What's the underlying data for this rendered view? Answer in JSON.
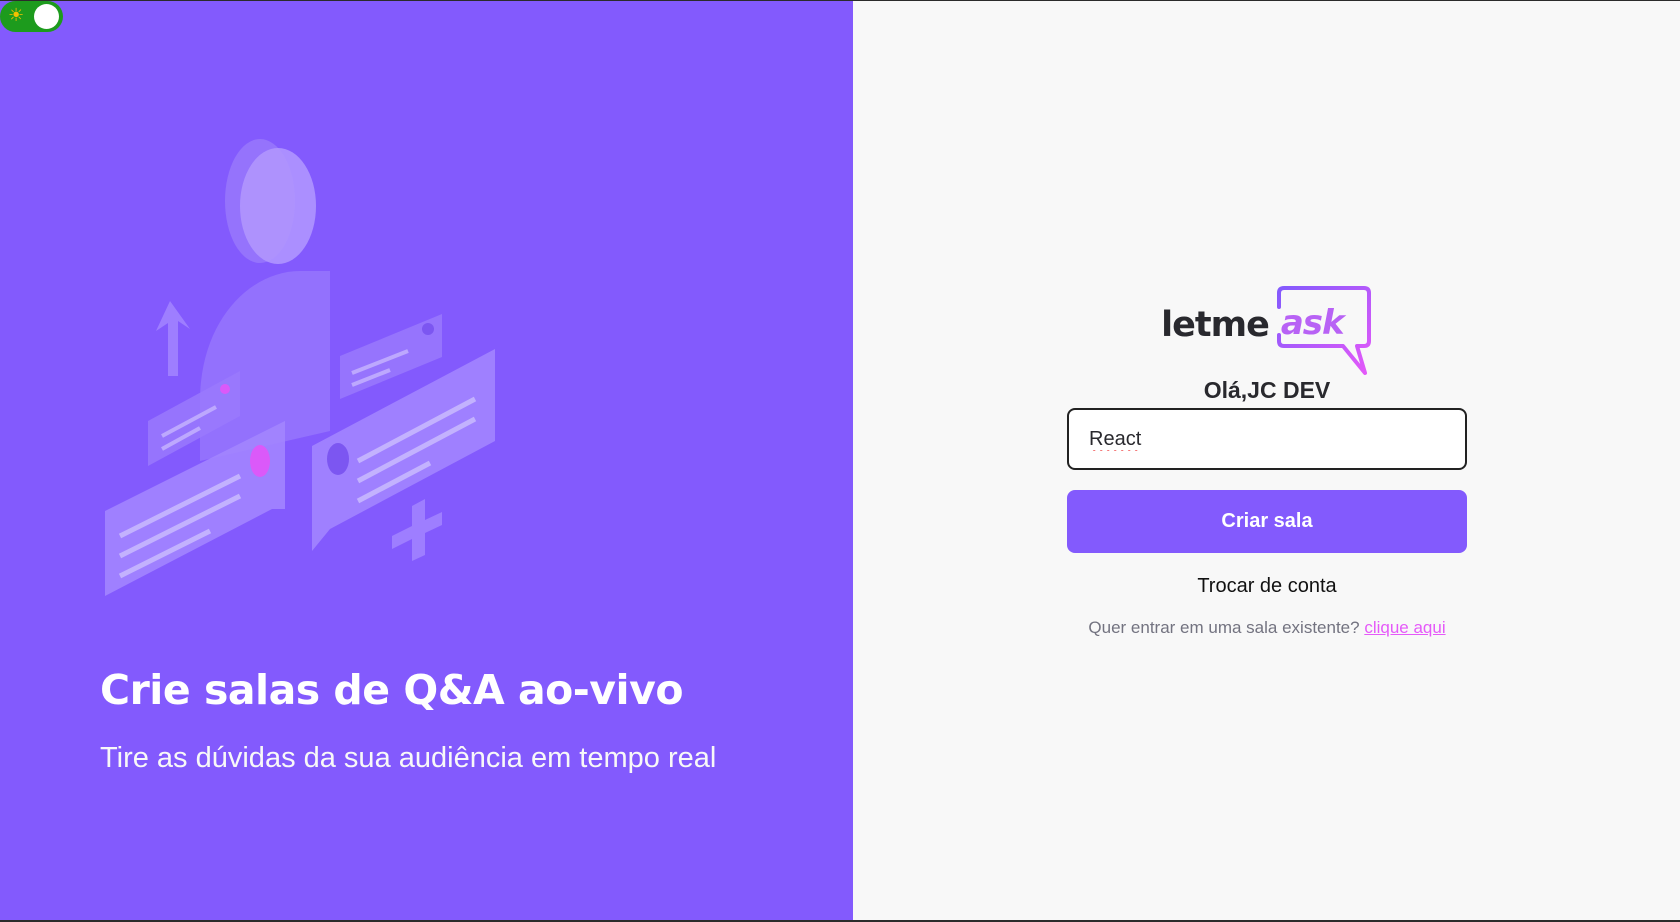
{
  "theme_toggle": {
    "icon": "sun-icon",
    "glyph": "☀",
    "state": "on"
  },
  "aside": {
    "title": "Crie salas de Q&A ao-vivo",
    "subtitle": "Tire as dúvidas da sua audiência em tempo real"
  },
  "logo": {
    "part1": "letme",
    "part2": "ask"
  },
  "greeting": "Olá,JC DEV",
  "room_input": {
    "value": "React",
    "placeholder": ""
  },
  "create_button": {
    "label": "Criar sala"
  },
  "switch_account": {
    "label": "Trocar de conta"
  },
  "join": {
    "text": "Quer entrar em uma sala existente?",
    "link": "clique aqui"
  },
  "colors": {
    "brand_purple": "#835afd",
    "accent_pink": "#e559f9",
    "toggle_green": "#1d9b1d",
    "background": "#f8f8f8"
  }
}
